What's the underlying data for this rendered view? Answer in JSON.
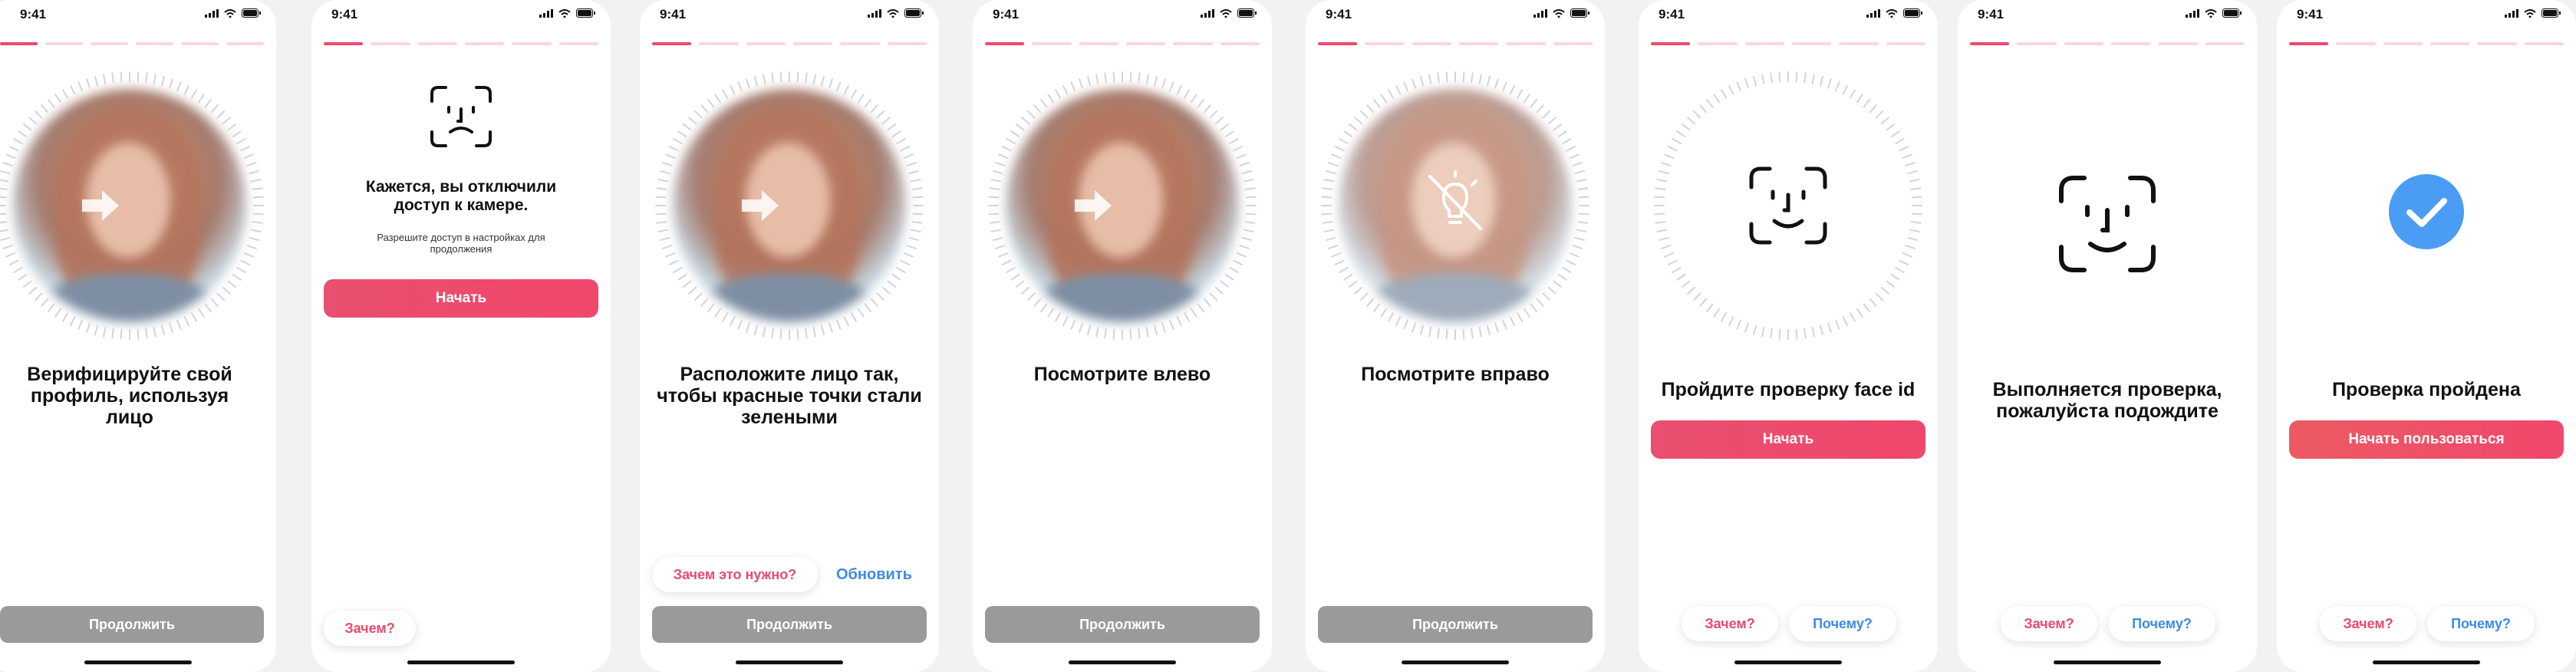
{
  "status_time": "9:41",
  "colors": {
    "accent": "#f0496b",
    "blue": "#3e8ae6",
    "grey_button": "#9a9a9a",
    "check_circle": "#4a9cf5"
  },
  "screens": [
    {
      "title": "Верифицируйте свой профиль, используя лицо",
      "continue_label": "Продолжить",
      "overlay_icon": "arrow-right-icon"
    },
    {
      "title": "Кажется, вы отключили доступ к камере.",
      "subtitle": "Разрешите доступ в настройках для продолжения",
      "start_label": "Начать",
      "why_label": "Зачем?",
      "icon": "face-sad-icon"
    },
    {
      "title": "Расположите лицо так, чтобы красные точки стали зелеными",
      "why_label": "Зачем это нужно?",
      "refresh_label": "Обновить",
      "continue_label": "Продолжить",
      "overlay_icon": "arrow-right-icon"
    },
    {
      "title": "Посмотрите влево",
      "continue_label": "Продолжить",
      "overlay_icon": "arrow-right-icon"
    },
    {
      "title": "Посмотрите вправо",
      "continue_label": "Продолжить",
      "overlay_icon": "no-light-icon"
    },
    {
      "title": "Пройдите проверку face id",
      "start_label": "Начать",
      "why_label": "Зачем?",
      "how_label": "Почему?",
      "icon": "face-id-icon"
    },
    {
      "title": "Выполняется проверка, пожалуйста подождите",
      "why_label": "Зачем?",
      "how_label": "Почему?",
      "icon": "face-id-icon"
    },
    {
      "title": "Проверка пройдена",
      "start_label": "Начать пользоваться",
      "why_label": "Зачем?",
      "how_label": "Почему?",
      "icon": "check-circle-icon"
    }
  ]
}
